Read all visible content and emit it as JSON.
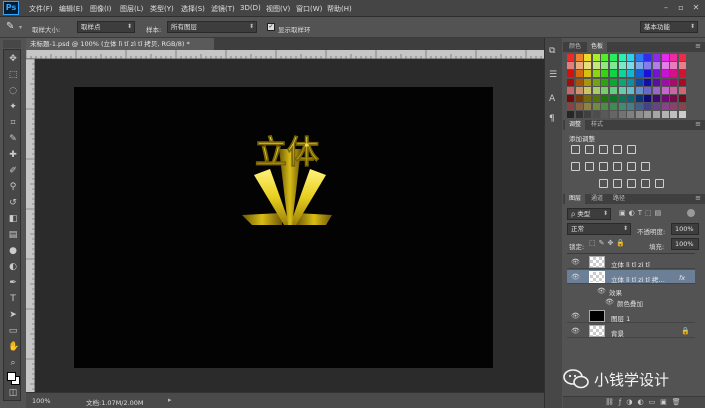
{
  "app": {
    "logo": "Ps"
  },
  "menu": [
    "文件(F)",
    "编辑(E)",
    "图像(I)",
    "图层(L)",
    "类型(Y)",
    "选择(S)",
    "滤镜(T)",
    "3D(D)",
    "视图(V)",
    "窗口(W)",
    "帮助(H)"
  ],
  "options": {
    "sample_size_label": "取样大小:",
    "sample_size_value": "取样点",
    "sample_label": "样本:",
    "sample_value": "所有图层",
    "show_ring_label": "显示取样环",
    "workspace": "基本功能"
  },
  "document": {
    "tab_title": "未标题-1.psd @ 100% (立体 lì tǐ zì tǐ 拷贝, RGB/8) *",
    "zoom": "100%",
    "doc_size": "文档:1.07M/2.00M"
  },
  "artwork": {
    "text": "立体",
    "color": "#e8cf1f"
  },
  "panels": {
    "color_tab": "颜色",
    "swatches_tab": "色板",
    "adjust_tab": "调整",
    "styles_tab": "样式",
    "adjust_title": "添加调整",
    "layers_tab": "图层",
    "channels_tab": "通道",
    "paths_tab": "路径"
  },
  "layers_panel": {
    "filter_kind": "类型",
    "blend_mode": "正常",
    "opacity_label": "不透明度:",
    "opacity_value": "100%",
    "lock_label": "锁定:",
    "fill_label": "填充:",
    "fill_value": "100%"
  },
  "layers": [
    {
      "name": "立体 lì tǐ zì tǐ",
      "selected": false
    },
    {
      "name": "立体 lì tǐ zì tǐ 拷…",
      "selected": true,
      "fx": "fx"
    }
  ],
  "effects": {
    "label": "效果",
    "item": "颜色叠加"
  },
  "layer1": {
    "name": "图层 1"
  },
  "background": {
    "name": "背景"
  },
  "watermark": {
    "text": "小钱学设计"
  }
}
